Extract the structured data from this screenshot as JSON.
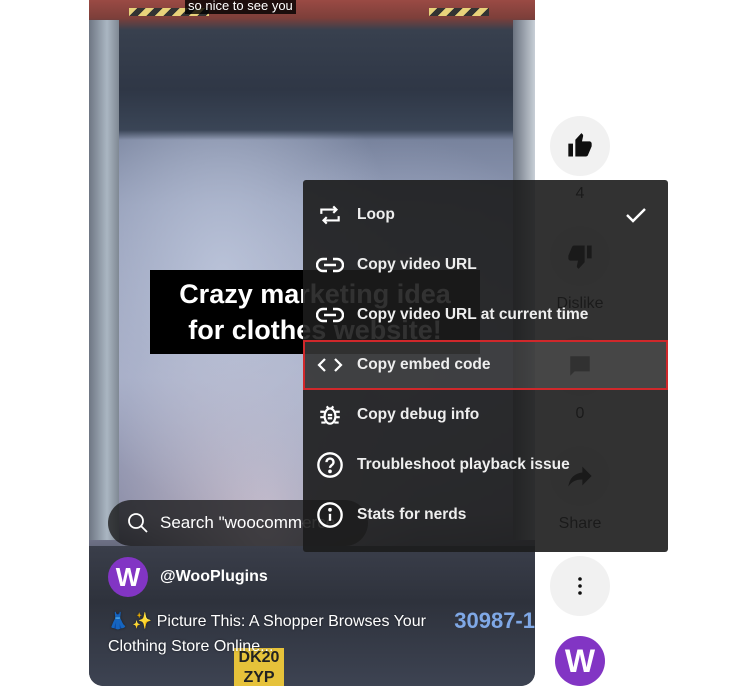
{
  "video": {
    "caption_top": "so nice to see you",
    "overlay_line1": "Crazy marketing idea",
    "overlay_line2": "for clothes website!",
    "search_text": "Search \"woocommerce",
    "channel_initial": "W",
    "channel_name": "@WooPlugins",
    "title_line1": "👗 ✨ Picture This: A Shopper Browses Your",
    "title_line2": "Clothing Store Online...",
    "plate_yellow": "DK20 ZYP",
    "plate_blue": "30987-1"
  },
  "actions": {
    "like_icon": "thumbs-up-icon",
    "like_count": "4",
    "dislike_icon": "thumbs-down-icon",
    "dislike_label": "Dislike",
    "comment_icon": "comment-icon",
    "comment_count": "0",
    "share_icon": "share-icon",
    "share_label": "Share",
    "more_icon": "more-vert-icon",
    "channel_initial": "W"
  },
  "menu": {
    "items": [
      {
        "label": "Loop",
        "icon": "loop-icon",
        "checked": true
      },
      {
        "label": "Copy video URL",
        "icon": "link-icon"
      },
      {
        "label": "Copy video URL at current time",
        "icon": "link-icon"
      },
      {
        "label": "Copy embed code",
        "icon": "code-icon",
        "highlighted": true
      },
      {
        "label": "Copy debug info",
        "icon": "bug-icon"
      },
      {
        "label": "Troubleshoot playback issue",
        "icon": "help-circle-icon"
      },
      {
        "label": "Stats for nerds",
        "icon": "info-circle-icon"
      }
    ]
  },
  "colors": {
    "highlight_border": "#d0282b",
    "avatar_purple": "#8235c4",
    "menu_bg": "#1c1c1c"
  }
}
